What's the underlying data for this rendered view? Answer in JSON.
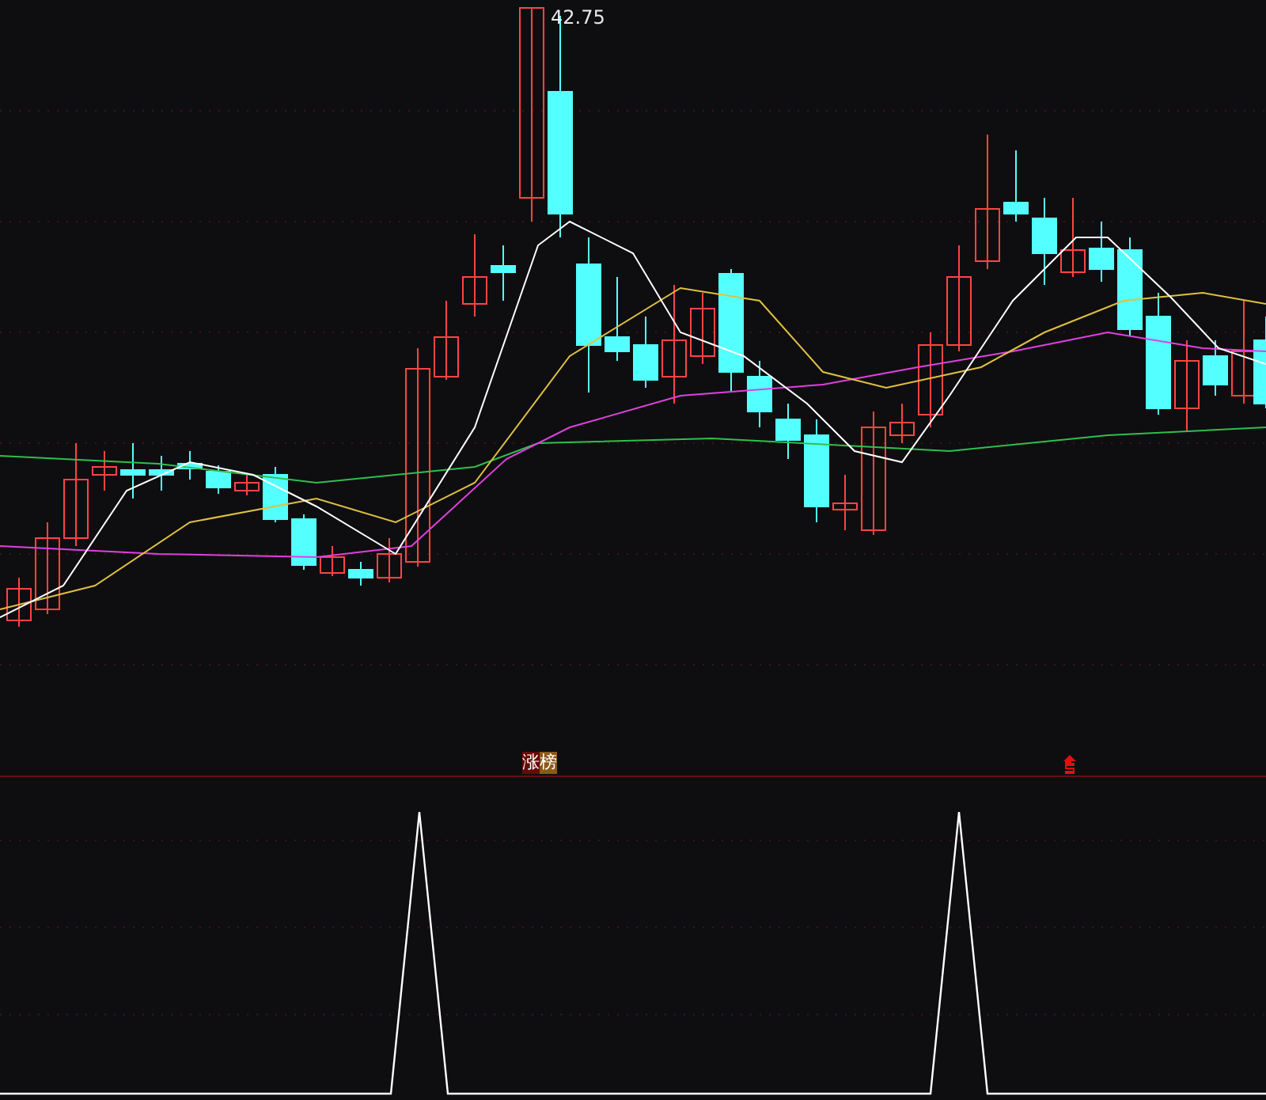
{
  "price_panel": {
    "high_label": "42.75"
  },
  "signal_panel": {
    "markers": [
      {
        "kind": "tag",
        "text": "涨榜"
      },
      {
        "kind": "arrow"
      }
    ]
  }
}
